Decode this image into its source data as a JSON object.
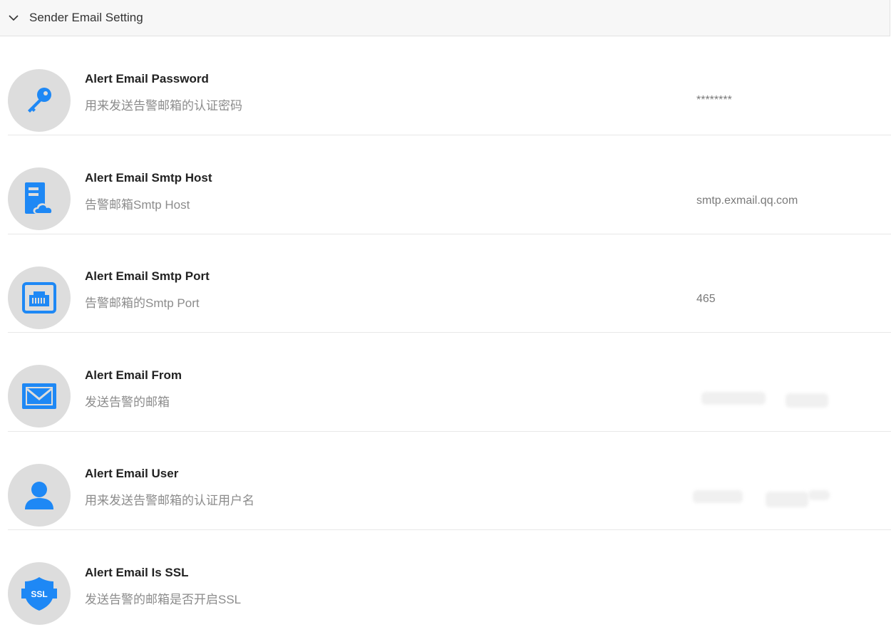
{
  "section": {
    "title": "Sender Email Setting",
    "expanded": true
  },
  "settings": [
    {
      "title": "Alert Email Password",
      "desc": "用来发送告警邮箱的认证密码",
      "value": "********",
      "icon": "key-icon"
    },
    {
      "title": "Alert Email Smtp Host",
      "desc": "告警邮箱Smtp Host",
      "value": "smtp.exmail.qq.com",
      "icon": "server-cloud-icon"
    },
    {
      "title": "Alert Email Smtp Port",
      "desc": "告警邮箱的Smtp Port",
      "value": "465",
      "icon": "network-port-icon"
    },
    {
      "title": "Alert Email From",
      "desc": "发送告警的邮箱",
      "value": "",
      "icon": "envelope-icon"
    },
    {
      "title": "Alert Email User",
      "desc": "用来发送告警邮箱的认证用户名",
      "value": "",
      "icon": "user-icon"
    },
    {
      "title": "Alert Email Is SSL",
      "desc": "发送告警的邮箱是否开启SSL",
      "value": "",
      "icon": "ssl-shield-icon"
    }
  ],
  "icon_labels": {
    "ssl": "SSL"
  },
  "colors": {
    "accent": "#1e88f5",
    "avatar_bg": "#dddddd",
    "header_bg": "#f7f7f7"
  }
}
